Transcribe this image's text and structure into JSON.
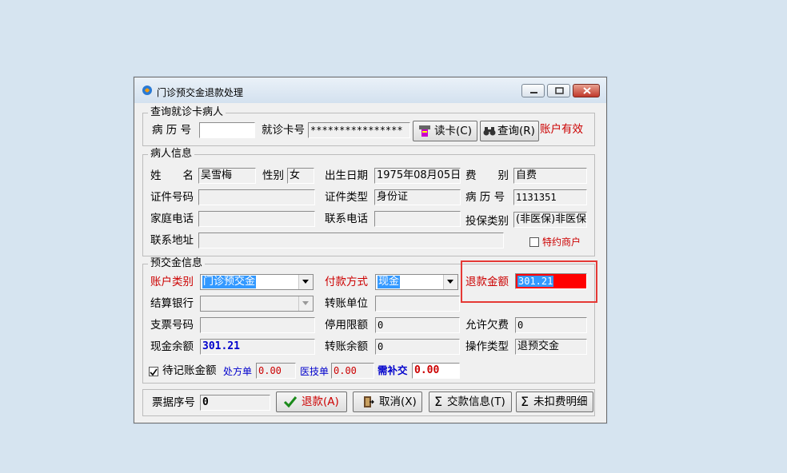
{
  "window": {
    "title": "门诊预交金退款处理"
  },
  "query": {
    "legend": "查询就诊卡病人",
    "record_no_label": "病 历 号",
    "record_no_value": "",
    "card_no_label": "就诊卡号",
    "card_no_value": "****************",
    "read_card_button": "读卡(C)",
    "search_button": "查询(R)",
    "account_status": "账户有效"
  },
  "patient": {
    "legend": "病人信息",
    "name_label": "姓　　名",
    "name_value": "吴雪梅",
    "gender_label": "性别",
    "gender_value": "女",
    "dob_label": "出生日期",
    "dob_value": "1975年08月05日",
    "fee_label": "费　　别",
    "fee_value": "自费",
    "id_no_label": "证件号码",
    "id_no_value": "",
    "id_type_label": "证件类型",
    "id_type_value": "身份证",
    "record_label": "病 历 号",
    "record_value": "1131351",
    "home_phone_label": "家庭电话",
    "home_phone_value": "",
    "contact_phone_label": "联系电话",
    "contact_phone_value": "",
    "insurance_label": "投保类别",
    "insurance_value": "(非医保)非医保",
    "address_label": "联系地址",
    "address_value": "",
    "special_merchant_label": "特约商户"
  },
  "deposit": {
    "legend": "预交金信息",
    "account_type_label": "账户类别",
    "account_type_value": "门诊预交金",
    "payment_method_label": "付款方式",
    "payment_method_value": "现金",
    "refund_amount_label": "退款金额",
    "refund_amount_value": "301.21",
    "bank_label": "结算银行",
    "bank_value": "",
    "transfer_unit_label": "转账单位",
    "transfer_unit_value": "",
    "check_no_label": "支票号码",
    "check_no_value": "",
    "stop_limit_label": "停用限额",
    "stop_limit_value": "0",
    "allow_owe_label": "允许欠费",
    "allow_owe_value": "0",
    "cash_balance_label": "现金余额",
    "cash_balance_value": "301.21",
    "transfer_balance_label": "转账余额",
    "transfer_balance_value": "0",
    "operation_type_label": "操作类型",
    "operation_type_value": "退预交金",
    "pending_label": "待记账金额",
    "prescription_label": "处方单",
    "prescription_value": "0.00",
    "medtech_label": "医技单",
    "medtech_value": "0.00",
    "supplement_label": "需补交",
    "supplement_value": "0.00"
  },
  "footer": {
    "receipt_label": "票据序号",
    "receipt_value": "0",
    "refund_button": "退款(A)",
    "cancel_button": "取消(X)",
    "payment_info_button": "交款信息(T)",
    "unpaid_detail_button": "未扣费明细"
  },
  "colors": {
    "highlight": "#e53935",
    "refund_field": "#ff0000",
    "label_red": "#cc0000",
    "value_blue": "#0000cc"
  }
}
